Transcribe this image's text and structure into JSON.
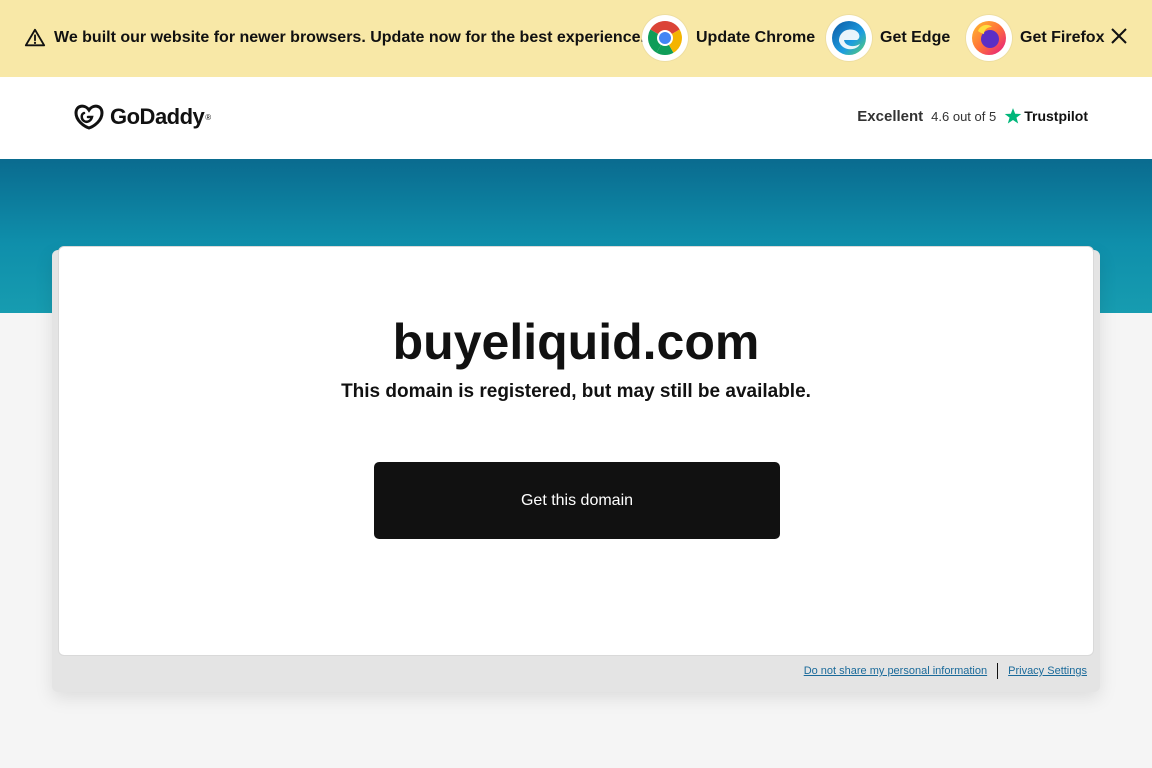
{
  "banner": {
    "message": "We built our website for newer browsers. Update now for the best experience.",
    "browsers": [
      {
        "label": "Update Chrome",
        "icon": "chrome-icon"
      },
      {
        "label": "Get Edge",
        "icon": "edge-icon"
      },
      {
        "label": "Get Firefox",
        "icon": "firefox-icon"
      }
    ],
    "icons": {
      "warning": "warning-icon",
      "close": "close-icon"
    }
  },
  "header": {
    "logo_text": "GoDaddy",
    "trustpilot": {
      "rating_word": "Excellent",
      "score_text": "4.6 out of 5",
      "brand": "Trustpilot",
      "star_color": "#00b67a"
    }
  },
  "main": {
    "domain": "buyeliquid.com",
    "subtitle": "This domain is registered, but may still be available.",
    "cta_label": "Get this domain"
  },
  "footer": {
    "links": [
      "Do not share my personal information",
      "Privacy Settings"
    ]
  },
  "colors": {
    "banner_bg": "#f8e8a7",
    "hero_gradient": [
      "#0a6b8f",
      "#179cb0"
    ],
    "cta_bg": "#111111",
    "link": "#1a6a9a"
  }
}
